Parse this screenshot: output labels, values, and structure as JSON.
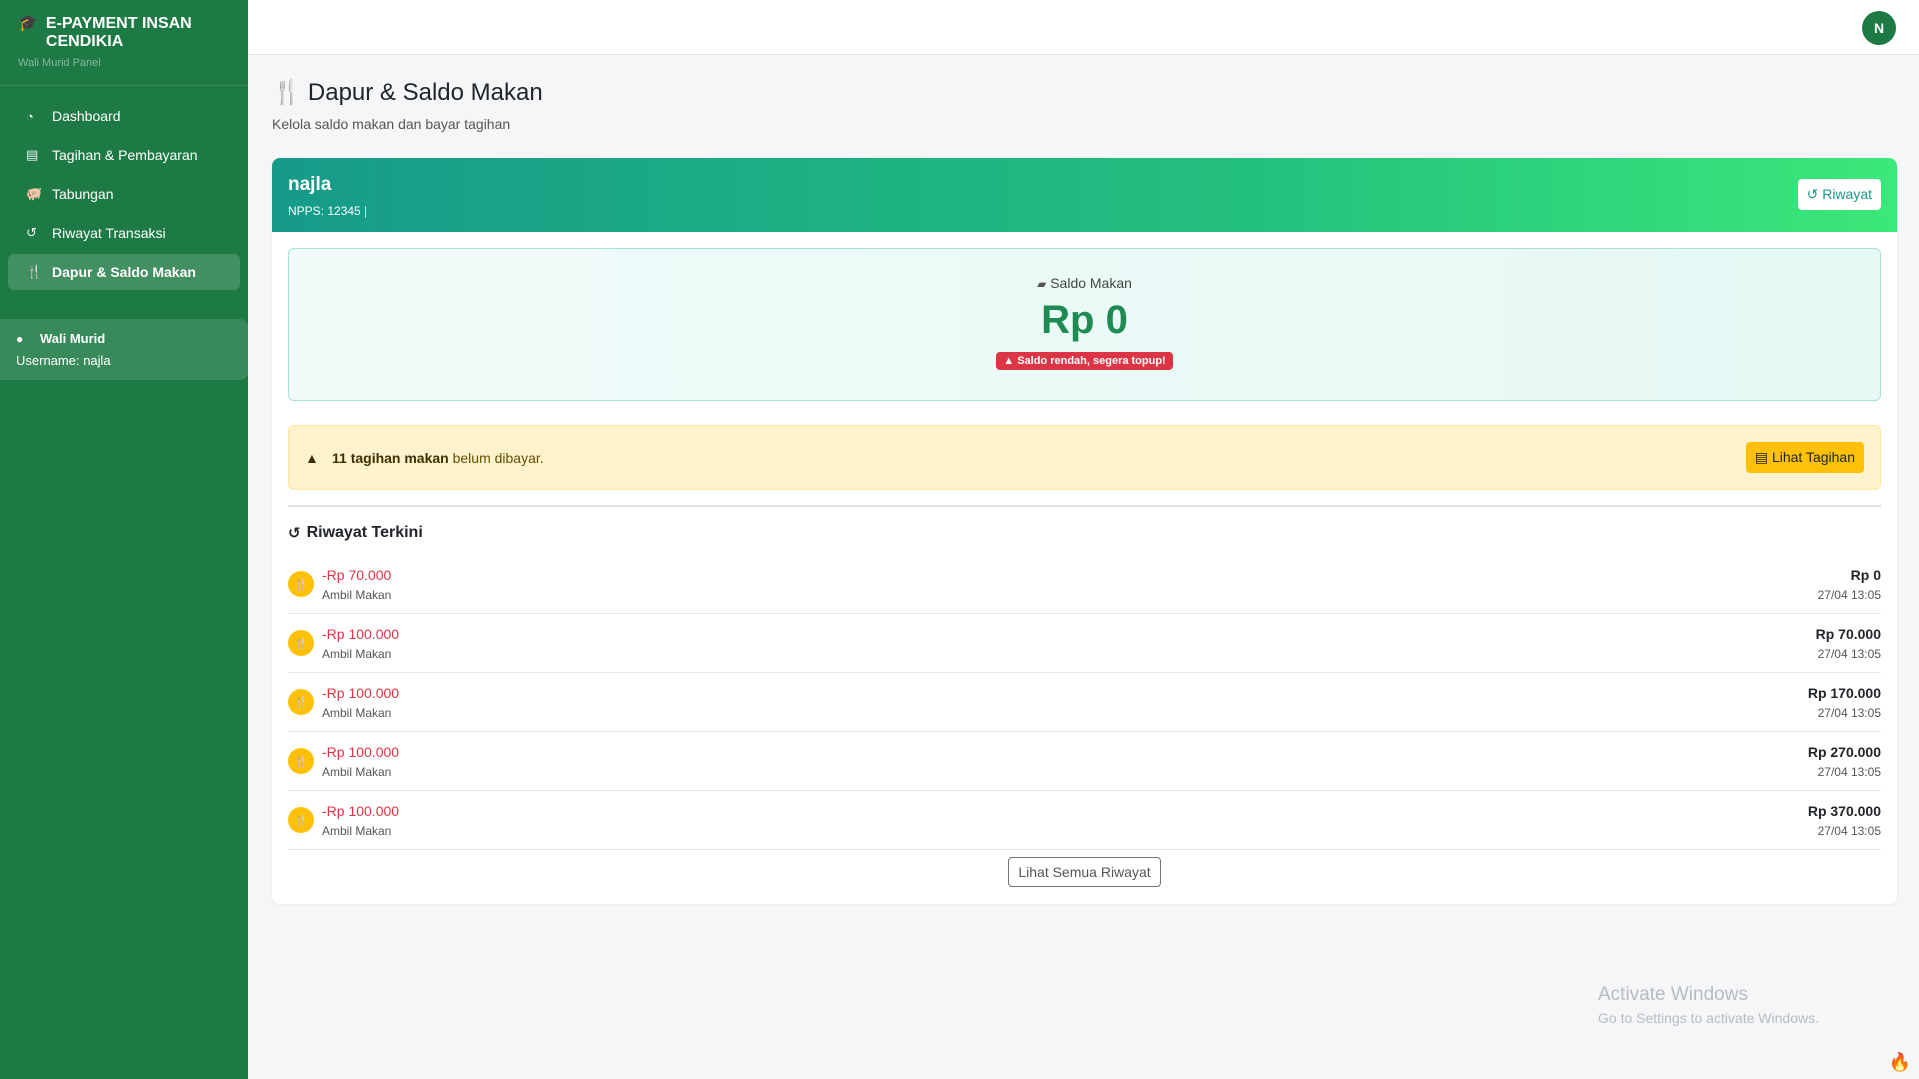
{
  "sidebar": {
    "brand_title": "E-PAYMENT INSAN CENDIKIA",
    "brand_subtitle": "Wali Murid Panel",
    "items": [
      {
        "label": "Dashboard",
        "icon": "gauge-icon"
      },
      {
        "label": "Tagihan & Pembayaran",
        "icon": "invoice-icon"
      },
      {
        "label": "Tabungan",
        "icon": "piggy-bank-icon"
      },
      {
        "label": "Riwayat Transaksi",
        "icon": "history-icon"
      },
      {
        "label": "Dapur & Saldo Makan",
        "icon": "utensils-icon",
        "active": true
      }
    ],
    "user": {
      "role": "Wali Murid",
      "username": "Username: najla"
    }
  },
  "topbar": {
    "avatar_initial": "N"
  },
  "page": {
    "title": "Dapur & Saldo Makan",
    "subtitle": "Kelola saldo makan dan bayar tagihan"
  },
  "student": {
    "name": "najla",
    "id_line": "NPPS: 12345 |",
    "history_button": "Riwayat"
  },
  "saldo": {
    "label": "Saldo Makan",
    "value": "Rp 0",
    "warning": "Saldo rendah, segera topup!"
  },
  "alert": {
    "count_text": "11 tagihan makan",
    "rest_text": " belum dibayar.",
    "button": "Lihat Tagihan"
  },
  "recent": {
    "title": "Riwayat Terkini",
    "transactions": [
      {
        "amount": "-Rp 70.000",
        "desc": "Ambil Makan",
        "balance": "Rp 0",
        "time": "27/04 13:05"
      },
      {
        "amount": "-Rp 100.000",
        "desc": "Ambil Makan",
        "balance": "Rp 70.000",
        "time": "27/04 13:05"
      },
      {
        "amount": "-Rp 100.000",
        "desc": "Ambil Makan",
        "balance": "Rp 170.000",
        "time": "27/04 13:05"
      },
      {
        "amount": "-Rp 100.000",
        "desc": "Ambil Makan",
        "balance": "Rp 270.000",
        "time": "27/04 13:05"
      },
      {
        "amount": "-Rp 100.000",
        "desc": "Ambil Makan",
        "balance": "Rp 370.000",
        "time": "27/04 13:05"
      }
    ],
    "more_button": "Lihat Semua Riwayat"
  },
  "watermark": {
    "title": "Activate Windows",
    "subtitle": "Go to Settings to activate Windows."
  },
  "colors": {
    "sidebar": "#1e7a45",
    "accent_green": "#1d8b52",
    "danger": "#dc3545",
    "warning": "#ffc107"
  }
}
